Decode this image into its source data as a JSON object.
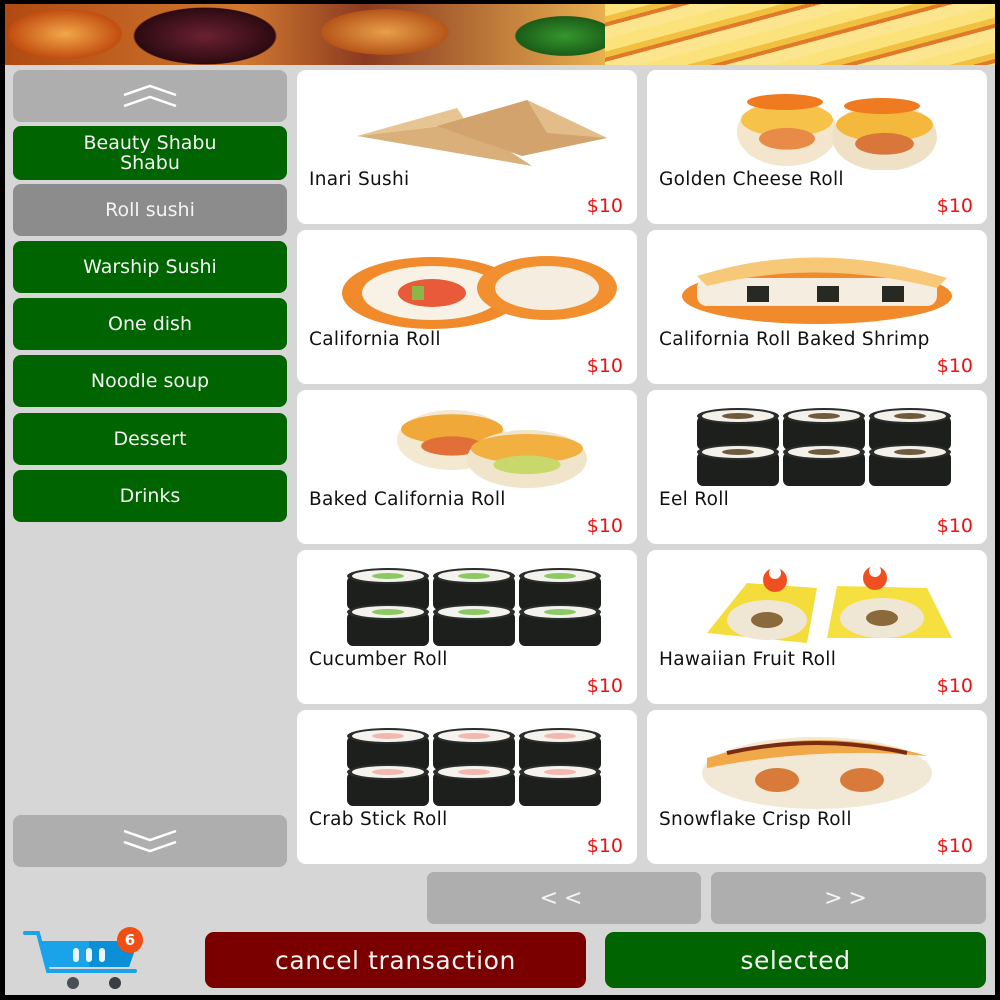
{
  "banner": {
    "icon": "food-banner-photo"
  },
  "sidebar": {
    "scroll_up_icon": "double-chevron-up-icon",
    "scroll_down_icon": "double-chevron-down-icon",
    "active_index": 1,
    "categories": [
      {
        "label": "Beauty Shabu Shabu"
      },
      {
        "label": "Roll sushi"
      },
      {
        "label": "Warship Sushi"
      },
      {
        "label": "One dish"
      },
      {
        "label": "Noodle soup"
      },
      {
        "label": "Dessert"
      },
      {
        "label": "Drinks"
      }
    ]
  },
  "products": [
    {
      "name": "Inari Sushi",
      "price": "$10",
      "image": "inari-sushi"
    },
    {
      "name": "Golden Cheese Roll",
      "price": "$10",
      "image": "golden-cheese-roll"
    },
    {
      "name": "California Roll",
      "price": "$10",
      "image": "california-roll"
    },
    {
      "name": "California Roll Baked Shrimp",
      "price": "$10",
      "image": "california-roll-baked-shrimp"
    },
    {
      "name": "Baked California Roll",
      "price": "$10",
      "image": "baked-california-roll"
    },
    {
      "name": "Eel Roll",
      "price": "$10",
      "image": "eel-roll"
    },
    {
      "name": "Cucumber Roll",
      "price": "$10",
      "image": "cucumber-roll"
    },
    {
      "name": "Hawaiian Fruit Roll",
      "price": "$10",
      "image": "hawaiian-fruit-roll"
    },
    {
      "name": "Crab Stick Roll",
      "price": "$10",
      "image": "crab-stick-roll"
    },
    {
      "name": "Snowflake Crisp Roll",
      "price": "$10",
      "image": "snowflake-crisp-roll"
    }
  ],
  "pagination": {
    "prev_label": "<<",
    "next_label": ">>"
  },
  "cart": {
    "count": "6",
    "icon": "shopping-cart-icon"
  },
  "actions": {
    "cancel_label": "cancel transaction",
    "selected_label": "selected"
  },
  "colors": {
    "category_green": "#006400",
    "category_active": "#8c8c8c",
    "scroll_gray": "#aeaeae",
    "price_red": "#ee1111",
    "cancel_red": "#7a0000",
    "selected_green": "#006400",
    "badge_orange": "#f04e12",
    "cart_blue": "#1aa3e8",
    "background": "#d6d6d6"
  }
}
